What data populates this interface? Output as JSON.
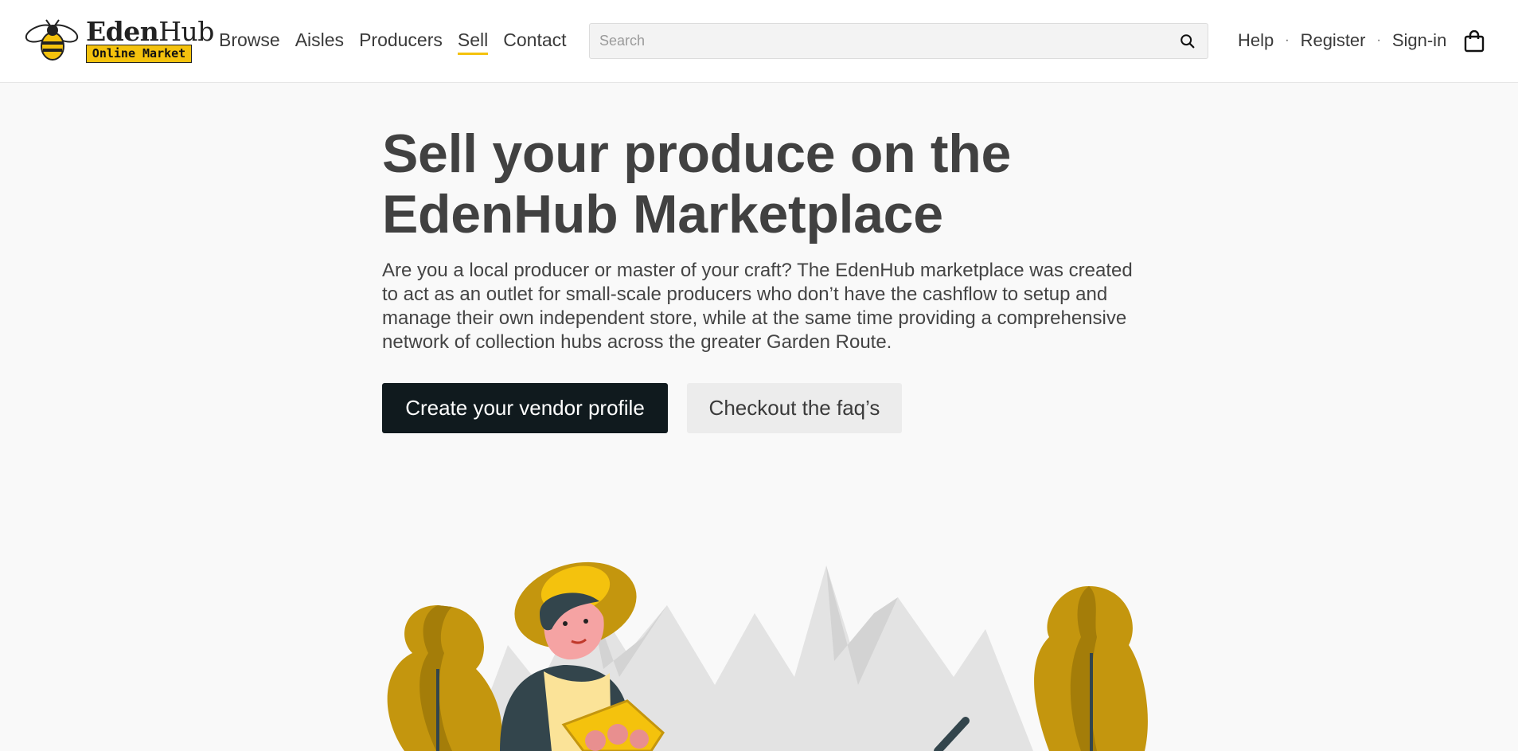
{
  "header": {
    "logo": {
      "word_bold": "Eden",
      "word_light": "Hub",
      "badge": "Online Market"
    },
    "nav": [
      {
        "label": "Browse",
        "active": false
      },
      {
        "label": "Aisles",
        "active": false
      },
      {
        "label": "Producers",
        "active": false
      },
      {
        "label": "Sell",
        "active": true
      },
      {
        "label": "Contact",
        "active": false
      }
    ],
    "search": {
      "placeholder": "Search",
      "value": ""
    },
    "links": {
      "help": "Help",
      "register": "Register",
      "signin": "Sign-in",
      "separator": "·"
    },
    "icons": {
      "search": "search-icon",
      "cart": "shopping-bag-icon"
    }
  },
  "hero": {
    "title_line1": "Sell your produce on the",
    "title_line2": "EdenHub Marketplace",
    "description": "Are you a local producer or master of your craft? The EdenHub marketplace was created to act as an outlet for small-scale producers who don’t have the cashflow to setup and manage their own independent store, while at the same time providing a comprehensive network of collection hubs across the greater Garden Route.",
    "primary_button": "Create your vendor profile",
    "secondary_button": "Checkout the faq’s"
  },
  "colors": {
    "accent": "#f4c20d",
    "primary_button": "#101a1e",
    "tree": "#c4960e",
    "mountain": "#e3e3e3",
    "heading": "#414141"
  }
}
